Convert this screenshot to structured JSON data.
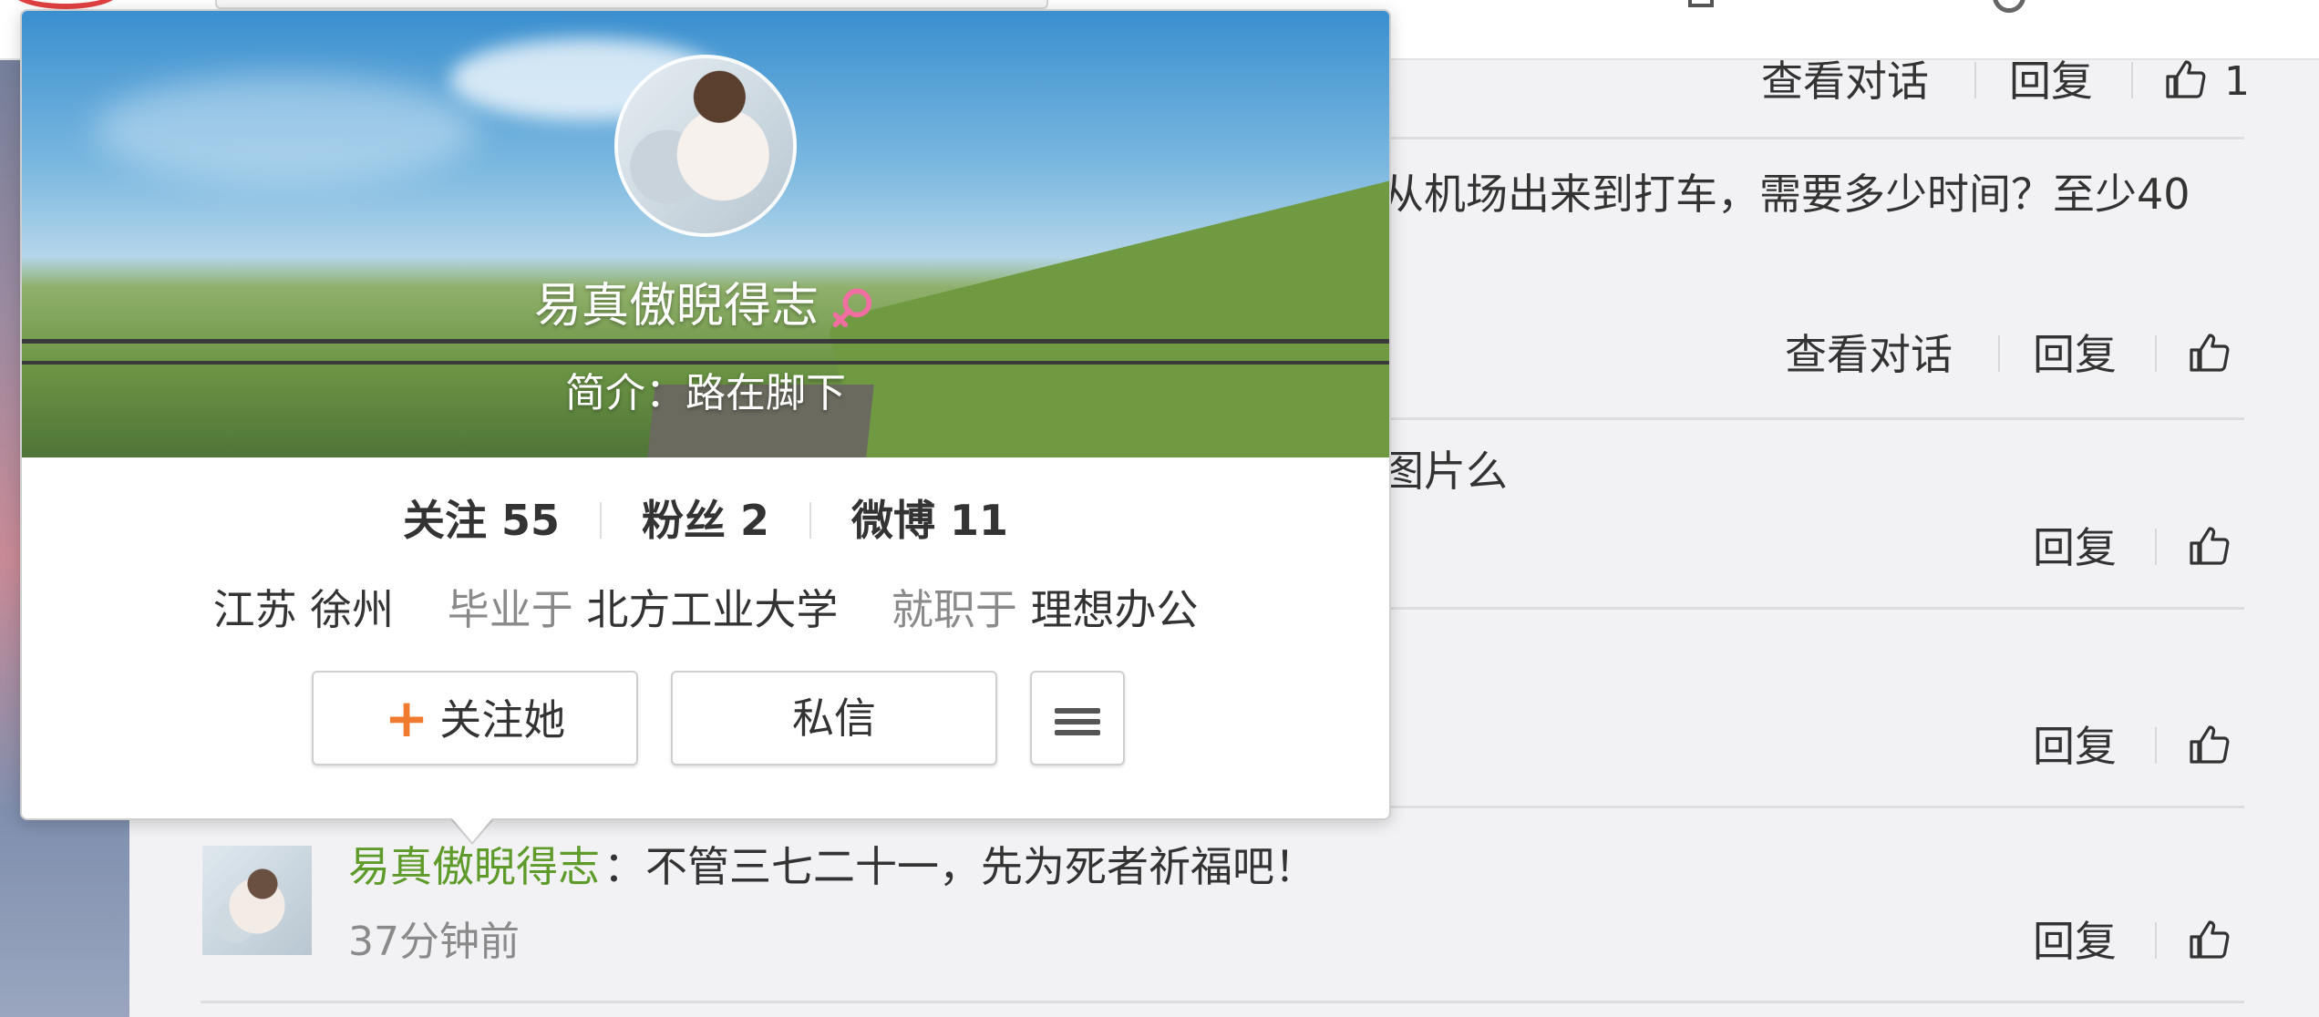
{
  "profile_card": {
    "name": "易真傲睨得志",
    "gender": "female",
    "bio": "简介：路在脚下",
    "stats": [
      {
        "label": "关注",
        "value": "55"
      },
      {
        "label": "粉丝",
        "value": "2"
      },
      {
        "label": "微博",
        "value": "11"
      }
    ],
    "location": "江苏 徐州",
    "graduated_label": "毕业于",
    "school": "北方工业大学",
    "employed_label": "就职于",
    "company": "理想办公",
    "follow_label": "关注她",
    "message_label": "私信",
    "colors": {
      "follow_plus": "#f07a2d",
      "gender_icon": "#f06ea0"
    }
  },
  "comments": {
    "row1": {
      "view_conversation": "查看对话",
      "reply": "回复",
      "like_count": "1"
    },
    "row2": {
      "text_fragment": "从机场出来到打车，需要多少时间？至少40",
      "view_conversation": "查看对话",
      "reply": "回复"
    },
    "row3": {
      "text_fragment": "图片么",
      "reply": "回复"
    },
    "row4": {
      "reply": "回复"
    },
    "row5": {
      "author": "易真傲睨得志",
      "body": "：不管三七二十一，先为死者祈福吧！",
      "time": "37分钟前",
      "reply": "回复"
    },
    "colors": {
      "author": "#5f9b2b"
    }
  }
}
